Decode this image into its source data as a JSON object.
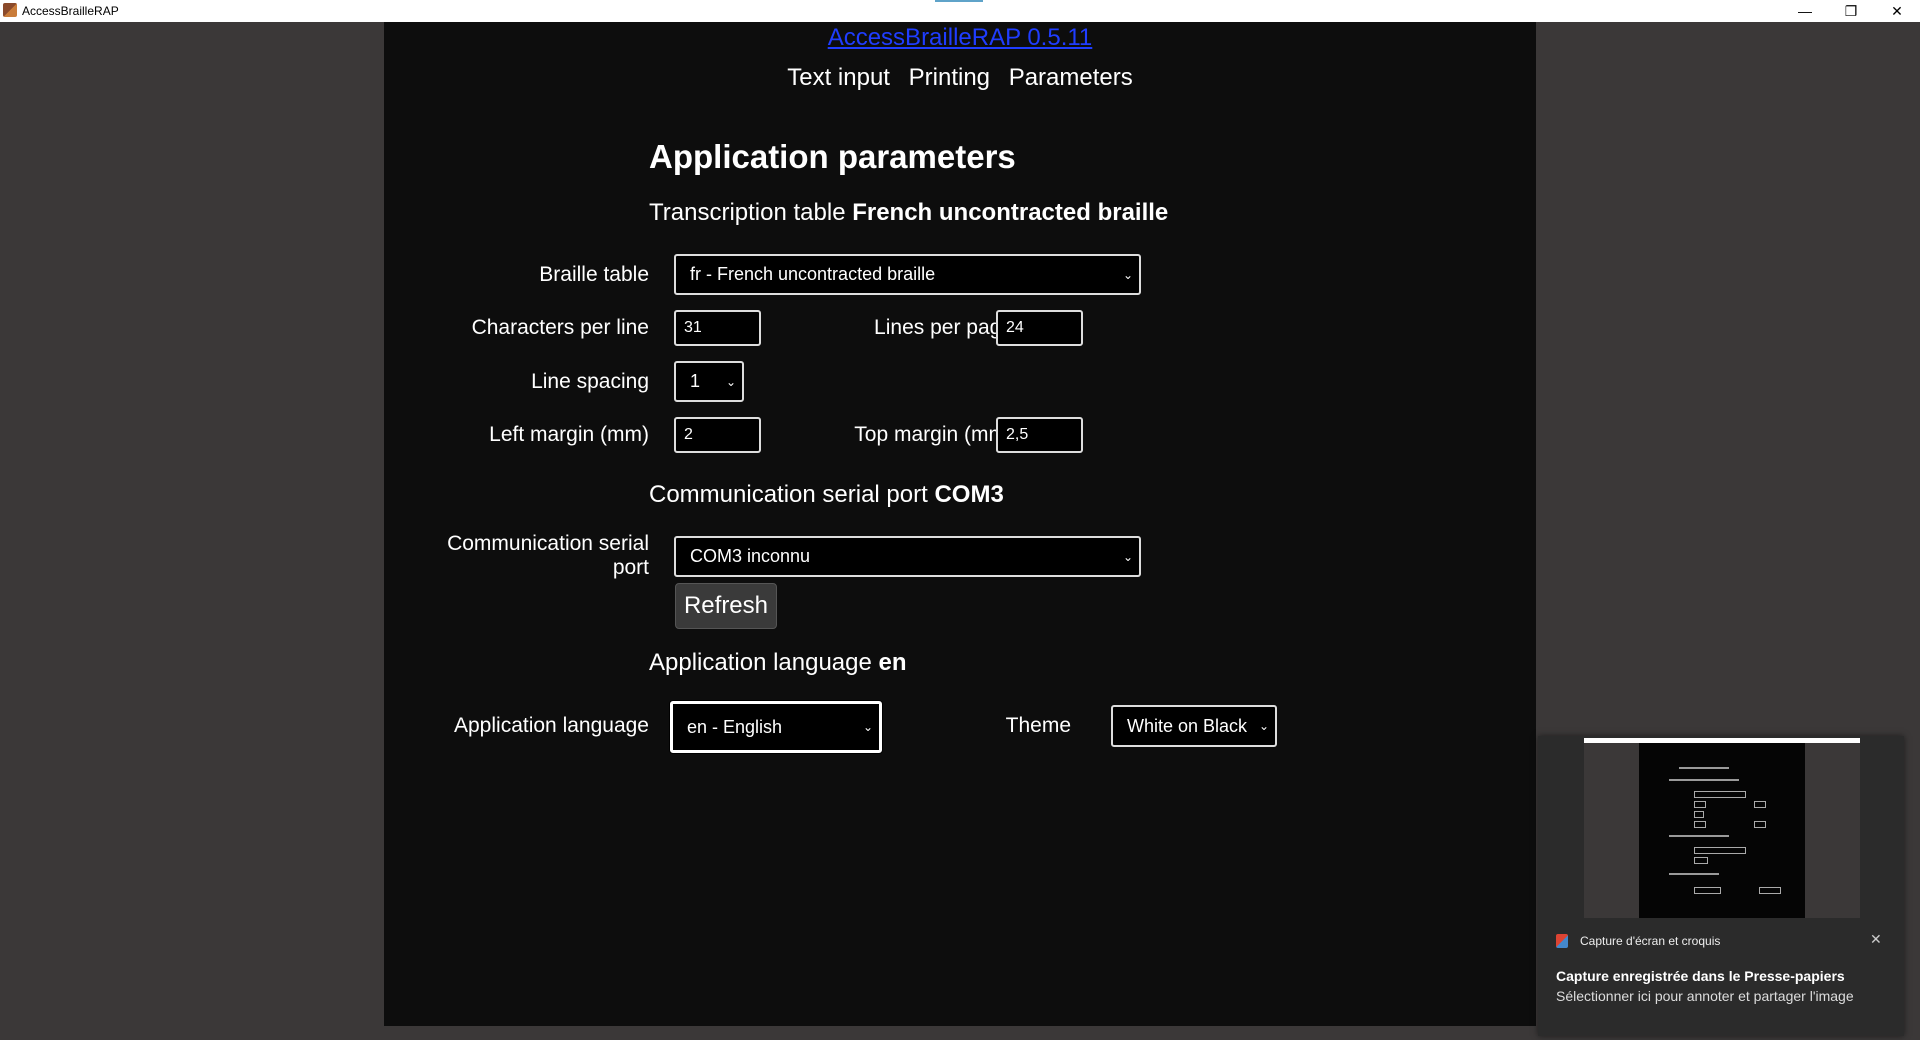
{
  "window": {
    "title": "AccessBrailleRAP",
    "min_glyph": "—",
    "max_glyph": "❐",
    "close_glyph": "✕"
  },
  "header": {
    "app_link": "AccessBrailleRAP 0.5.11",
    "nav": [
      "Text input",
      "Printing",
      "Parameters"
    ]
  },
  "page": {
    "title": "Application parameters",
    "transcription_prefix": "Transcription table ",
    "transcription_value": "French uncontracted braille",
    "braille_table_label": "Braille table",
    "braille_table_value": "fr - French uncontracted braille",
    "chars_per_line_label": "Characters per line",
    "chars_per_line_value": "31",
    "lines_per_page_label": "Lines per page",
    "lines_per_page_value": "24",
    "line_spacing_label": "Line spacing",
    "line_spacing_value": "1",
    "left_margin_label": "Left margin (mm)",
    "left_margin_value": "2",
    "top_margin_label": "Top margin (mm)",
    "top_margin_value": "2,5",
    "serial_prefix": "Communication serial port ",
    "serial_value": "COM3",
    "serial_label_1": "Communication serial",
    "serial_label_2": "port",
    "serial_select_value": "COM3 inconnu",
    "refresh_label": "Refresh",
    "language_prefix": "Application language ",
    "language_value": "en",
    "language_label": "Application language",
    "language_select_value": "en - English",
    "theme_label": "Theme",
    "theme_value": "White on Black",
    "chevron": "⌄"
  },
  "toast": {
    "app_name": "Capture d'écran et croquis",
    "title": "Capture enregistrée dans le Presse-papiers",
    "subtitle": "Sélectionner ici pour annoter et partager l'image",
    "close_glyph": "✕"
  }
}
